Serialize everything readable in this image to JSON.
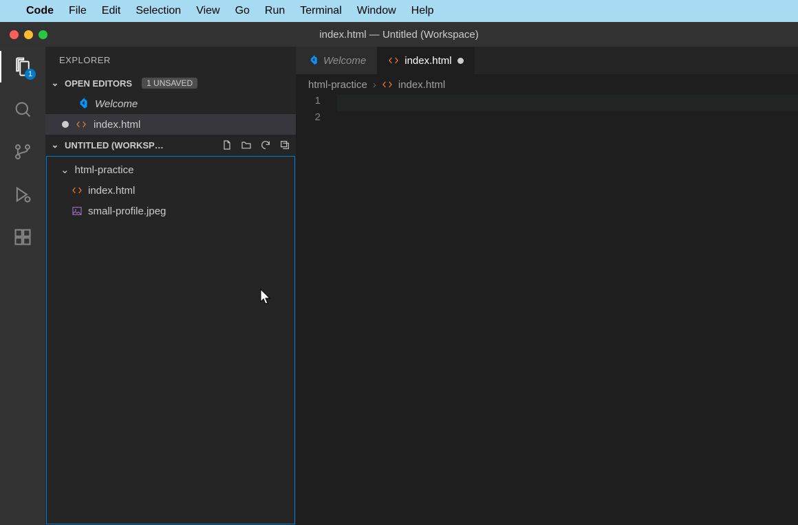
{
  "menubar": {
    "apple": "",
    "app": "Code",
    "items": [
      "File",
      "Edit",
      "Selection",
      "View",
      "Go",
      "Run",
      "Terminal",
      "Window",
      "Help"
    ]
  },
  "window": {
    "title": "index.html — Untitled (Workspace)"
  },
  "activitybar": {
    "badge": "1"
  },
  "sidebar": {
    "title": "EXPLORER",
    "openEditors": {
      "label": "OPEN EDITORS",
      "unsaved": "1 UNSAVED",
      "items": [
        {
          "name": "Welcome",
          "kind": "welcome",
          "modified": false
        },
        {
          "name": "index.html",
          "kind": "html",
          "modified": true
        }
      ]
    },
    "workspace": {
      "label": "UNTITLED (WORKSP…"
    },
    "tree": {
      "folder": "html-practice",
      "files": [
        {
          "name": "index.html",
          "kind": "html"
        },
        {
          "name": "small-profile.jpeg",
          "kind": "image"
        }
      ]
    }
  },
  "tabs": [
    {
      "name": "Welcome",
      "kind": "welcome",
      "active": false,
      "modified": false
    },
    {
      "name": "index.html",
      "kind": "html",
      "active": true,
      "modified": true
    }
  ],
  "breadcrumbs": {
    "folder": "html-practice",
    "file": "index.html"
  },
  "editor": {
    "lines": [
      "1",
      "2"
    ]
  }
}
